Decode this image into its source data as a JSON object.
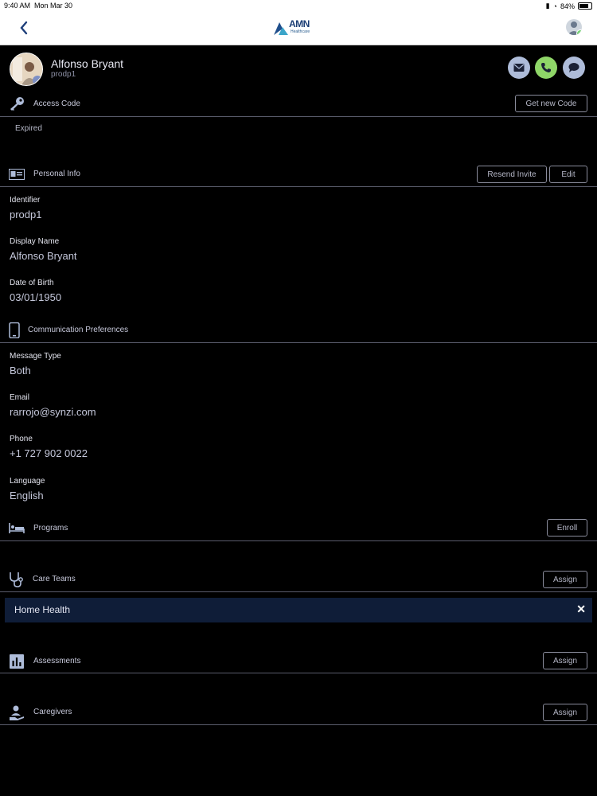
{
  "status": {
    "time": "9:40 AM",
    "date": "Mon Mar 30",
    "battery": "84%"
  },
  "brand": {
    "name": "AMN",
    "sub": "Healthcare"
  },
  "patient": {
    "name": "Alfonso Bryant",
    "id": "prodp1"
  },
  "access": {
    "title": "Access Code",
    "button": "Get new Code",
    "status": "Expired"
  },
  "personal": {
    "title": "Personal Info",
    "resend": "Resend Invite",
    "edit": "Edit",
    "identifier_label": "Identifier",
    "identifier": "prodp1",
    "display_label": "Display Name",
    "display": "Alfonso Bryant",
    "dob_label": "Date of Birth",
    "dob": "03/01/1950"
  },
  "comm": {
    "title": "Communication Preferences",
    "type_label": "Message Type",
    "type": "Both",
    "email_label": "Email",
    "email": "rarrojo@synzi.com",
    "phone_label": "Phone",
    "phone": "+1 727 902 0022",
    "lang_label": "Language",
    "lang": "English"
  },
  "programs": {
    "title": "Programs",
    "button": "Enroll"
  },
  "careteams": {
    "title": "Care Teams",
    "button": "Assign",
    "items": [
      {
        "name": "Home Health"
      }
    ]
  },
  "assessments": {
    "title": "Assessments",
    "button": "Assign"
  },
  "caregivers": {
    "title": "Caregivers",
    "button": "Assign"
  },
  "colors": {
    "accent": "#aebcd9",
    "call": "#8fd668",
    "background": "#000000",
    "highlight_row": "#0f1d38"
  }
}
